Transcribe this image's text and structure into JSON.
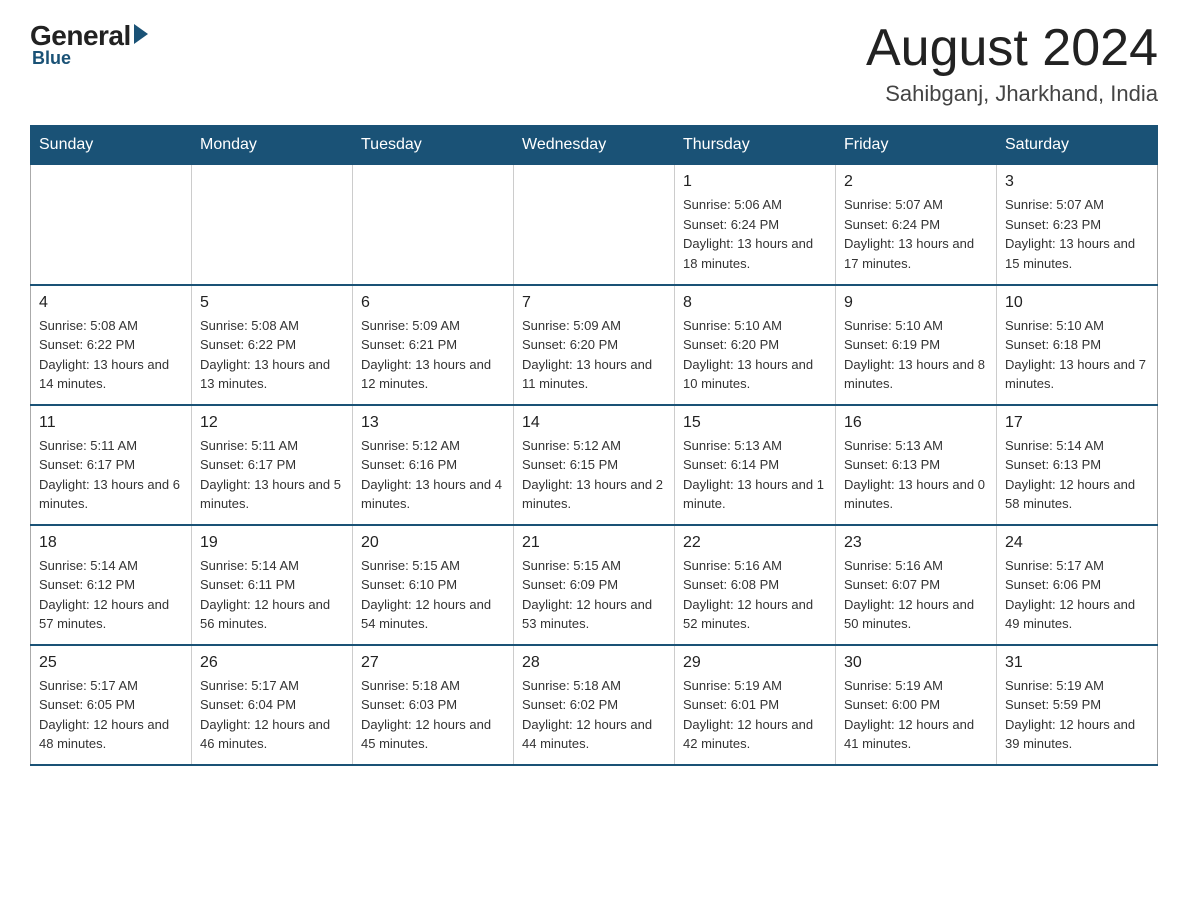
{
  "header": {
    "logo": {
      "general": "General",
      "blue": "Blue",
      "subtitle": "Blue"
    },
    "title": "August 2024",
    "location": "Sahibganj, Jharkhand, India"
  },
  "calendar": {
    "days_of_week": [
      "Sunday",
      "Monday",
      "Tuesday",
      "Wednesday",
      "Thursday",
      "Friday",
      "Saturday"
    ],
    "weeks": [
      [
        {
          "day": "",
          "info": ""
        },
        {
          "day": "",
          "info": ""
        },
        {
          "day": "",
          "info": ""
        },
        {
          "day": "",
          "info": ""
        },
        {
          "day": "1",
          "info": "Sunrise: 5:06 AM\nSunset: 6:24 PM\nDaylight: 13 hours and 18 minutes."
        },
        {
          "day": "2",
          "info": "Sunrise: 5:07 AM\nSunset: 6:24 PM\nDaylight: 13 hours and 17 minutes."
        },
        {
          "day": "3",
          "info": "Sunrise: 5:07 AM\nSunset: 6:23 PM\nDaylight: 13 hours and 15 minutes."
        }
      ],
      [
        {
          "day": "4",
          "info": "Sunrise: 5:08 AM\nSunset: 6:22 PM\nDaylight: 13 hours and 14 minutes."
        },
        {
          "day": "5",
          "info": "Sunrise: 5:08 AM\nSunset: 6:22 PM\nDaylight: 13 hours and 13 minutes."
        },
        {
          "day": "6",
          "info": "Sunrise: 5:09 AM\nSunset: 6:21 PM\nDaylight: 13 hours and 12 minutes."
        },
        {
          "day": "7",
          "info": "Sunrise: 5:09 AM\nSunset: 6:20 PM\nDaylight: 13 hours and 11 minutes."
        },
        {
          "day": "8",
          "info": "Sunrise: 5:10 AM\nSunset: 6:20 PM\nDaylight: 13 hours and 10 minutes."
        },
        {
          "day": "9",
          "info": "Sunrise: 5:10 AM\nSunset: 6:19 PM\nDaylight: 13 hours and 8 minutes."
        },
        {
          "day": "10",
          "info": "Sunrise: 5:10 AM\nSunset: 6:18 PM\nDaylight: 13 hours and 7 minutes."
        }
      ],
      [
        {
          "day": "11",
          "info": "Sunrise: 5:11 AM\nSunset: 6:17 PM\nDaylight: 13 hours and 6 minutes."
        },
        {
          "day": "12",
          "info": "Sunrise: 5:11 AM\nSunset: 6:17 PM\nDaylight: 13 hours and 5 minutes."
        },
        {
          "day": "13",
          "info": "Sunrise: 5:12 AM\nSunset: 6:16 PM\nDaylight: 13 hours and 4 minutes."
        },
        {
          "day": "14",
          "info": "Sunrise: 5:12 AM\nSunset: 6:15 PM\nDaylight: 13 hours and 2 minutes."
        },
        {
          "day": "15",
          "info": "Sunrise: 5:13 AM\nSunset: 6:14 PM\nDaylight: 13 hours and 1 minute."
        },
        {
          "day": "16",
          "info": "Sunrise: 5:13 AM\nSunset: 6:13 PM\nDaylight: 13 hours and 0 minutes."
        },
        {
          "day": "17",
          "info": "Sunrise: 5:14 AM\nSunset: 6:13 PM\nDaylight: 12 hours and 58 minutes."
        }
      ],
      [
        {
          "day": "18",
          "info": "Sunrise: 5:14 AM\nSunset: 6:12 PM\nDaylight: 12 hours and 57 minutes."
        },
        {
          "day": "19",
          "info": "Sunrise: 5:14 AM\nSunset: 6:11 PM\nDaylight: 12 hours and 56 minutes."
        },
        {
          "day": "20",
          "info": "Sunrise: 5:15 AM\nSunset: 6:10 PM\nDaylight: 12 hours and 54 minutes."
        },
        {
          "day": "21",
          "info": "Sunrise: 5:15 AM\nSunset: 6:09 PM\nDaylight: 12 hours and 53 minutes."
        },
        {
          "day": "22",
          "info": "Sunrise: 5:16 AM\nSunset: 6:08 PM\nDaylight: 12 hours and 52 minutes."
        },
        {
          "day": "23",
          "info": "Sunrise: 5:16 AM\nSunset: 6:07 PM\nDaylight: 12 hours and 50 minutes."
        },
        {
          "day": "24",
          "info": "Sunrise: 5:17 AM\nSunset: 6:06 PM\nDaylight: 12 hours and 49 minutes."
        }
      ],
      [
        {
          "day": "25",
          "info": "Sunrise: 5:17 AM\nSunset: 6:05 PM\nDaylight: 12 hours and 48 minutes."
        },
        {
          "day": "26",
          "info": "Sunrise: 5:17 AM\nSunset: 6:04 PM\nDaylight: 12 hours and 46 minutes."
        },
        {
          "day": "27",
          "info": "Sunrise: 5:18 AM\nSunset: 6:03 PM\nDaylight: 12 hours and 45 minutes."
        },
        {
          "day": "28",
          "info": "Sunrise: 5:18 AM\nSunset: 6:02 PM\nDaylight: 12 hours and 44 minutes."
        },
        {
          "day": "29",
          "info": "Sunrise: 5:19 AM\nSunset: 6:01 PM\nDaylight: 12 hours and 42 minutes."
        },
        {
          "day": "30",
          "info": "Sunrise: 5:19 AM\nSunset: 6:00 PM\nDaylight: 12 hours and 41 minutes."
        },
        {
          "day": "31",
          "info": "Sunrise: 5:19 AM\nSunset: 5:59 PM\nDaylight: 12 hours and 39 minutes."
        }
      ]
    ]
  }
}
